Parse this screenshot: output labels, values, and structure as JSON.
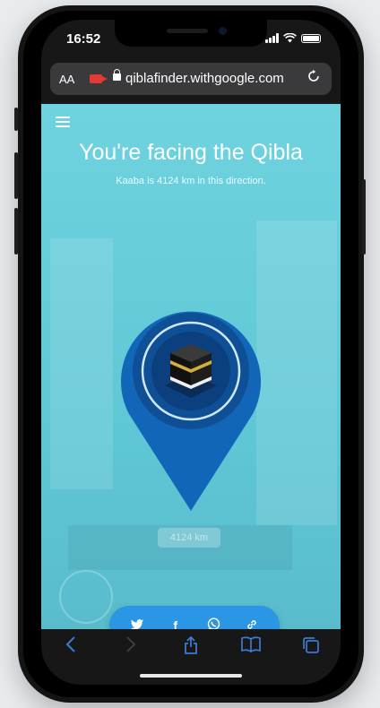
{
  "status_bar": {
    "time": "16:52"
  },
  "browser": {
    "text_size_label": "AA",
    "url": "qiblafinder.withgoogle.com"
  },
  "page": {
    "title": "You're facing the Qibla",
    "subtitle": "Kaaba is 4124 km in this direction.",
    "distance_label": "4124 km"
  },
  "share": {
    "twitter": "twitter-icon",
    "facebook": "f",
    "whatsapp": "whatsapp-icon",
    "link": "link-icon"
  },
  "colors": {
    "page_bg": "#6fd3df",
    "pin_outer": "#1266b8",
    "pin_inner": "#0b3f7d",
    "share_bar": "#2b96e3",
    "safari_blue": "#3a7bd5"
  }
}
